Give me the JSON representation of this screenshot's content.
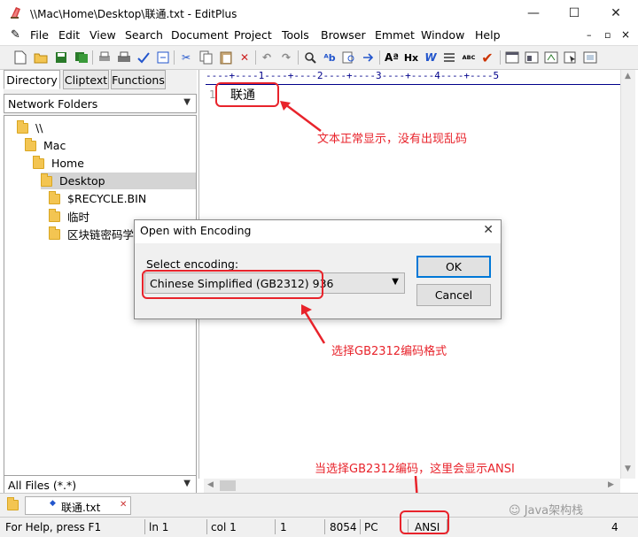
{
  "window": {
    "title": "\\\\Mac\\Home\\Desktop\\联通.txt - EditPlus",
    "minimize": "—",
    "maximize": "☐",
    "close": "✕",
    "mdi_minimize": "–",
    "mdi_restore": "▫",
    "mdi_close": "×"
  },
  "menu": [
    "File",
    "Edit",
    "View",
    "Search",
    "Document",
    "Project",
    "Tools",
    "Browser",
    "Emmet",
    "Window",
    "Help"
  ],
  "toolbar": {
    "hx_label": "Hx",
    "w_label": "W",
    "abc_label": "ABC"
  },
  "left_pane": {
    "tabs": [
      "Directory",
      "Cliptext",
      "Functions"
    ],
    "folder_combo": "Network Folders",
    "tree": [
      {
        "label": "\\\\",
        "indent": 0
      },
      {
        "label": "Mac",
        "indent": 1
      },
      {
        "label": "Home",
        "indent": 2
      },
      {
        "label": "Desktop",
        "indent": 3,
        "selected": true
      },
      {
        "label": "$RECYCLE.BIN",
        "indent": 4
      },
      {
        "label": "临时",
        "indent": 4
      },
      {
        "label": "区块链密码学笔记",
        "indent": 4
      }
    ],
    "filter_combo": "All Files (*.*)"
  },
  "editor": {
    "ruler": "----+----1----+----2----+----3----+----4----+----5",
    "line_number": "1",
    "text": "联通"
  },
  "dialog": {
    "title": "Open with Encoding",
    "close": "✕",
    "label": "Select encoding:",
    "selected_encoding": "Chinese Simplified (GB2312) 936",
    "ok": "OK",
    "cancel": "Cancel"
  },
  "file_tab": {
    "name": "联通.txt",
    "close": "✕"
  },
  "status": {
    "help": "For Help, press F1",
    "ln": "ln 1",
    "col": "col 1",
    "count": "1",
    "size": "8054",
    "mode": "PC",
    "encoding": "ANSI",
    "last": "4"
  },
  "annotations": {
    "text_ok": "文本正常显示，没有出现乱码",
    "select_enc": "选择GB2312编码格式",
    "ansi_note": "当选择GB2312编码，这里会显示ANSI"
  },
  "watermark": "Java架构栈",
  "colors": {
    "annotation": "#e8232b",
    "ruler": "#00008a",
    "default_button_border": "#0078d7"
  }
}
